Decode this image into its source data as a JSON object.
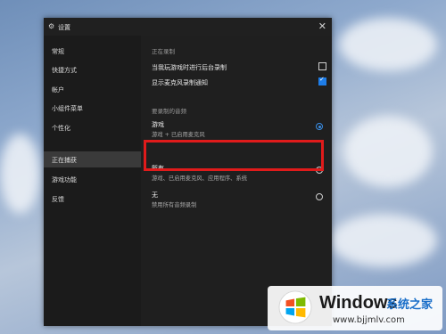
{
  "settings": {
    "title": "设置",
    "close_glyph": "✕",
    "gear_glyph": "⚙"
  },
  "sidebar": {
    "items": [
      {
        "label": "常规",
        "active": false
      },
      {
        "label": "快捷方式",
        "active": false
      },
      {
        "label": "帐户",
        "active": false
      },
      {
        "label": "小组件菜单",
        "active": false
      },
      {
        "label": "个性化",
        "active": false
      },
      {
        "label": "正在捕获",
        "active": true
      },
      {
        "label": "游戏功能",
        "active": false
      },
      {
        "label": "反馈",
        "active": false
      }
    ]
  },
  "capture": {
    "section_title": "正在录制",
    "checks": [
      {
        "label": "当我玩游戏时进行后台录制",
        "checked": false
      },
      {
        "label": "显示麦克风录制通知",
        "checked": true
      }
    ],
    "audio_title": "要录制的音频",
    "options": [
      {
        "label": "游戏",
        "sub": "游戏 + 已启用麦克风",
        "selected": true
      },
      {
        "label": "所有",
        "sub": "游戏、已启用麦克风、应用程序、系统",
        "selected": false
      },
      {
        "label": "无",
        "sub": "禁用所有音频录制",
        "selected": false
      }
    ]
  },
  "watermark": {
    "brand": "Windows",
    "sub": "系统之家",
    "url": "www.bjjmlv.com"
  },
  "colors": {
    "accent": "#1e7de8",
    "highlight": "#e01b1b"
  }
}
